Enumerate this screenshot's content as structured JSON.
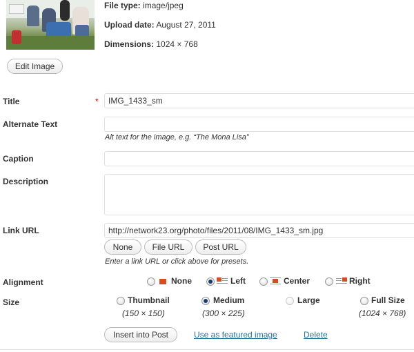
{
  "meta": {
    "file_type_label": "File type:",
    "file_type_value": "image/jpeg",
    "upload_date_label": "Upload date:",
    "upload_date_value": "August 27, 2011",
    "dimensions_label": "Dimensions:",
    "dimensions_value": "1024 × 768"
  },
  "edit_image_label": "Edit Image",
  "fields": {
    "title": {
      "label": "Title",
      "required_mark": "*",
      "value": "IMG_1433_sm"
    },
    "alt_text": {
      "label": "Alternate Text",
      "value": "",
      "help": "Alt text for the image, e.g. “The Mona Lisa”"
    },
    "caption": {
      "label": "Caption",
      "value": ""
    },
    "description": {
      "label": "Description",
      "value": ""
    },
    "link_url": {
      "label": "Link URL",
      "value": "http://network23.org/photo/files/2011/08/IMG_1433_sm.jpg",
      "presets": [
        "None",
        "File URL",
        "Post URL"
      ],
      "help": "Enter a link URL or click above for presets."
    }
  },
  "alignment": {
    "label": "Alignment",
    "selected": "Left",
    "options": [
      "None",
      "Left",
      "Center",
      "Right"
    ]
  },
  "size": {
    "label": "Size",
    "selected": "Medium",
    "options": [
      {
        "name": "Thumbnail",
        "dims": "(150 × 150)",
        "enabled": true
      },
      {
        "name": "Medium",
        "dims": "(300 × 225)",
        "enabled": true
      },
      {
        "name": "Large",
        "dims": "",
        "enabled": false
      },
      {
        "name": "Full Size",
        "dims": "(1024 × 768)",
        "enabled": true
      }
    ]
  },
  "actions": {
    "insert_label": "Insert into Post",
    "featured_label": "Use as featured image",
    "delete_label": "Delete"
  },
  "colors": {
    "link": "#21759b",
    "required": "#cc0000",
    "align_icon_image": "#d54e21"
  }
}
